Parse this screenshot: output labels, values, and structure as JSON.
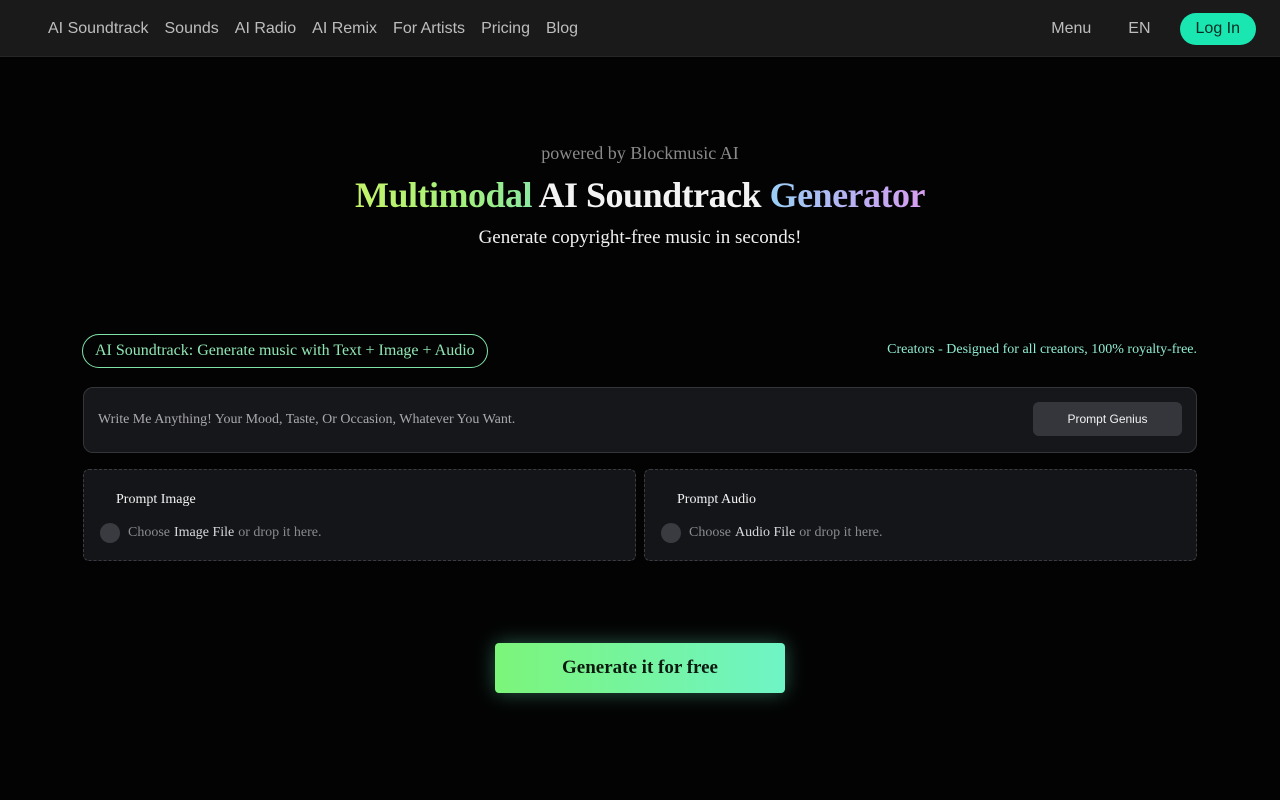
{
  "nav": {
    "links": [
      "AI Soundtrack",
      "Sounds",
      "AI Radio",
      "AI Remix",
      "For Artists",
      "Pricing",
      "Blog"
    ],
    "menu": "Menu",
    "lang": "EN",
    "login": "Log In"
  },
  "hero": {
    "powered": "powered by Blockmusic AI",
    "title_part1": "Multimodal",
    "title_part2": " AI Soundtrack ",
    "title_part3": "Generator",
    "subtitle": "Generate copyright-free music in seconds!"
  },
  "feature": {
    "pill": "AI Soundtrack: Generate music with Text + Image + Audio",
    "creators": "Creators - Designed for all creators, 100% royalty-free."
  },
  "prompt": {
    "placeholder": "Write Me Anything! Your Mood, Taste, Or Occasion, Whatever You Want.",
    "value": "",
    "genius_button": "Prompt Genius"
  },
  "uploads": {
    "image": {
      "title": "Prompt Image",
      "choose": "Choose",
      "file": "Image File",
      "drop": "or drop it here."
    },
    "audio": {
      "title": "Prompt Audio",
      "choose": "Choose",
      "file": "Audio File",
      "drop": "or drop it here."
    }
  },
  "cta": {
    "label": "Generate it for free"
  },
  "colors": {
    "accent": "#19e6b0",
    "background": "#030303",
    "nav_bg": "#1a1a1a",
    "cta_start": "#7cf57a",
    "cta_end": "#6ff4c6"
  }
}
